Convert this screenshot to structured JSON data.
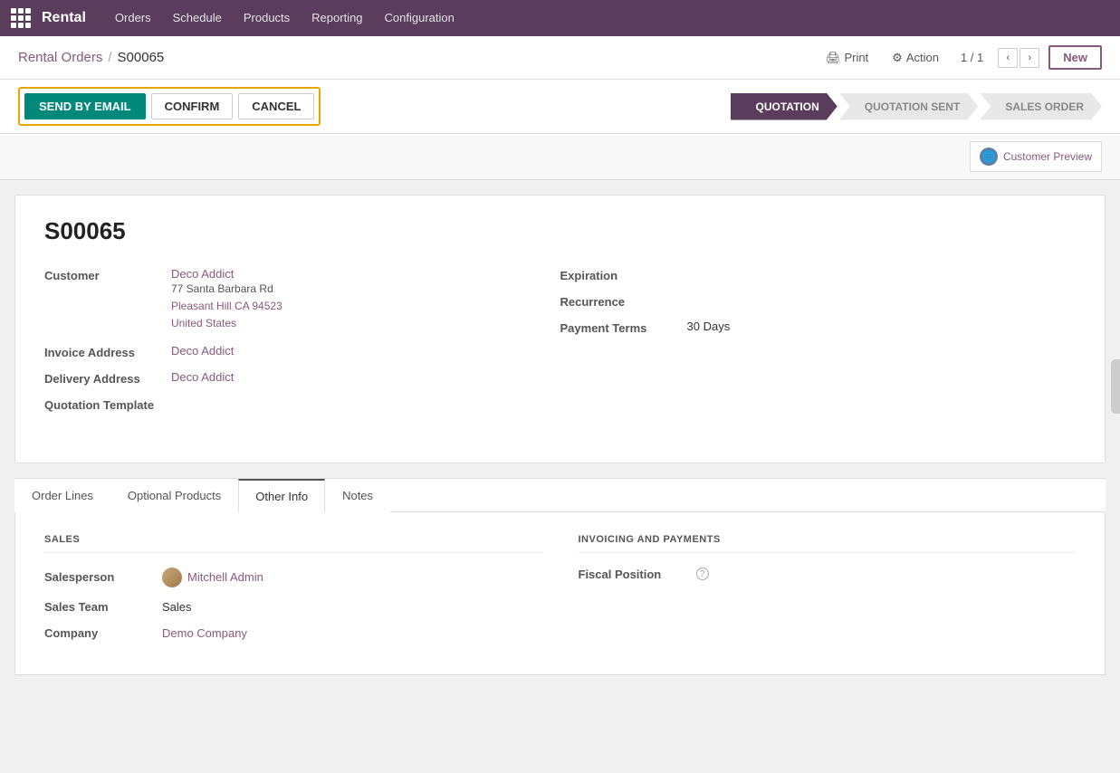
{
  "nav": {
    "brand": "Rental",
    "items": [
      "Orders",
      "Schedule",
      "Products",
      "Reporting",
      "Configuration"
    ]
  },
  "header": {
    "breadcrumb_parent": "Rental Orders",
    "breadcrumb_current": "S00065",
    "print_label": "Print",
    "action_label": "Action",
    "counter": "1 / 1",
    "new_label": "New"
  },
  "action_bar": {
    "send_email_label": "SEND BY EMAIL",
    "confirm_label": "CONFIRM",
    "cancel_label": "CANCEL"
  },
  "pipeline": {
    "steps": [
      "QUOTATION",
      "QUOTATION SENT",
      "SALES ORDER"
    ],
    "active_index": 0
  },
  "customer_preview": {
    "label": "Customer Preview"
  },
  "form": {
    "order_number": "S00065",
    "customer_label": "Customer",
    "customer_name": "Deco Addict",
    "customer_address1": "77 Santa Barbara Rd",
    "customer_address2": "Pleasant Hill CA 94523",
    "customer_address3": "United States",
    "invoice_address_label": "Invoice Address",
    "invoice_address": "Deco Addict",
    "delivery_address_label": "Delivery Address",
    "delivery_address": "Deco Addict",
    "quotation_template_label": "Quotation Template",
    "expiration_label": "Expiration",
    "recurrence_label": "Recurrence",
    "payment_terms_label": "Payment Terms",
    "payment_terms_value": "30 Days"
  },
  "tabs": {
    "items": [
      "Order Lines",
      "Optional Products",
      "Other Info",
      "Notes"
    ],
    "active": "Other Info"
  },
  "other_info": {
    "sales_section_title": "SALES",
    "invoicing_section_title": "INVOICING AND PAYMENTS",
    "salesperson_label": "Salesperson",
    "salesperson_value": "Mitchell Admin",
    "sales_team_label": "Sales Team",
    "sales_team_value": "Sales",
    "company_label": "Company",
    "company_value": "Demo Company",
    "fiscal_position_label": "Fiscal Position"
  }
}
